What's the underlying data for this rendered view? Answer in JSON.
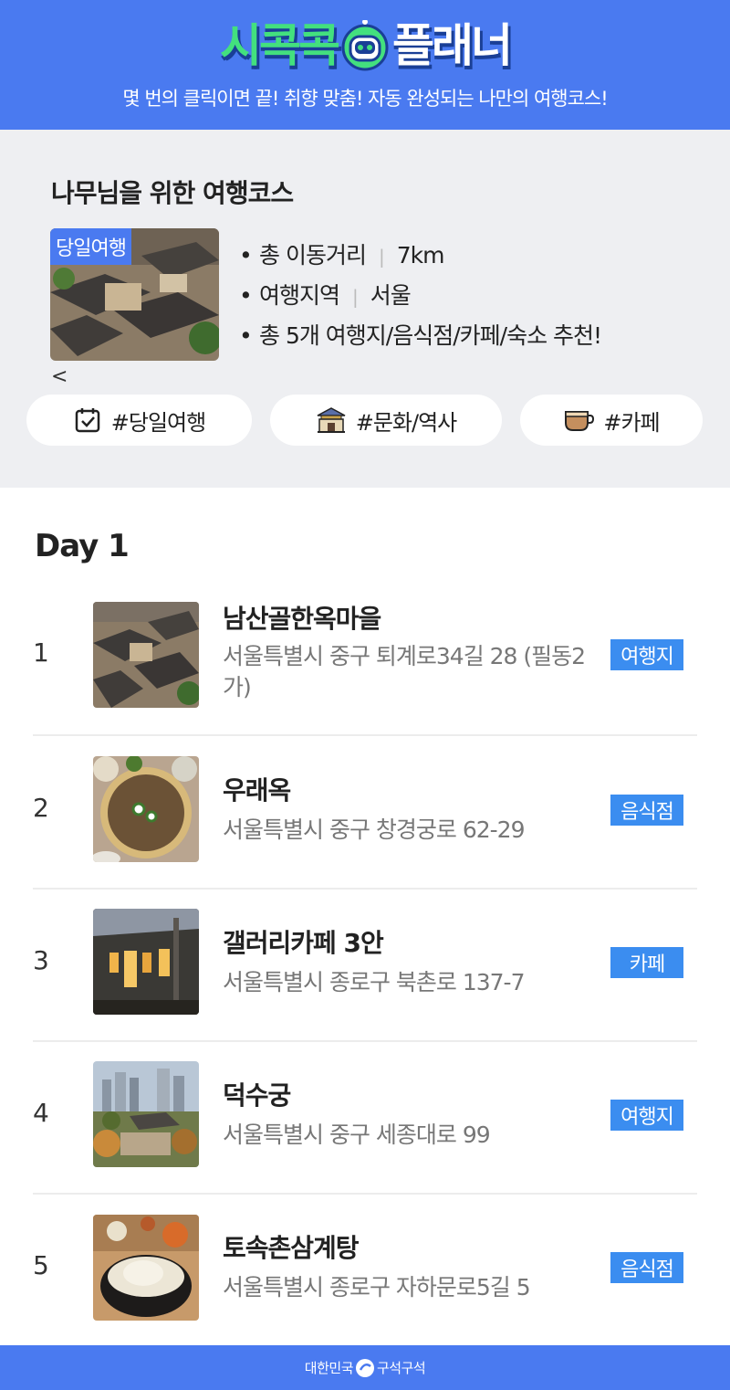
{
  "header": {
    "logo_left": "시콕콕",
    "logo_right": "플래너",
    "tagline": "몇 번의 클릭이면 끝! 취향 맞춤! 자동 완성되는 나만의 여행코스!"
  },
  "summary": {
    "title": "나무님을 위한 여행코스",
    "badge": "당일여행",
    "distance_label": "총 이동거리",
    "distance_value": "7km",
    "region_label": "여행지역",
    "region_value": "서울",
    "count_text": "총 5개 여행지/음식점/카페/숙소 추천!",
    "back_arrow": "<",
    "tags": [
      "#당일여행",
      "#문화/역사",
      "#카페"
    ]
  },
  "day": {
    "title": "Day 1",
    "items": [
      {
        "num": "1",
        "name": "남산골한옥마을",
        "address": "서울특별시 중구 퇴계로34길 28 (필동2가)",
        "category": "여행지"
      },
      {
        "num": "2",
        "name": "우래옥",
        "address": "서울특별시 중구 창경궁로 62-29",
        "category": "음식점"
      },
      {
        "num": "3",
        "name": "갤러리카페 3안",
        "address": "서울특별시 종로구 북촌로 137-7",
        "category": "카페"
      },
      {
        "num": "4",
        "name": "덕수궁",
        "address": "서울특별시 중구 세종대로 99",
        "category": "여행지"
      },
      {
        "num": "5",
        "name": "토속촌삼계탕",
        "address": "서울특별시 종로구 자하문로5길 5",
        "category": "음식점"
      }
    ]
  },
  "footer": {
    "left": "대한민국",
    "right": "구석구석"
  },
  "colors": {
    "brand_blue": "#4a7af0",
    "badge_blue": "#3b8df0",
    "logo_green": "#43e07e",
    "summary_bg": "#eeeff2"
  },
  "icons": [
    "robot-icon",
    "calendar-check-icon",
    "palace-gate-icon",
    "coffee-cup-icon",
    "footer-logo-icon"
  ]
}
